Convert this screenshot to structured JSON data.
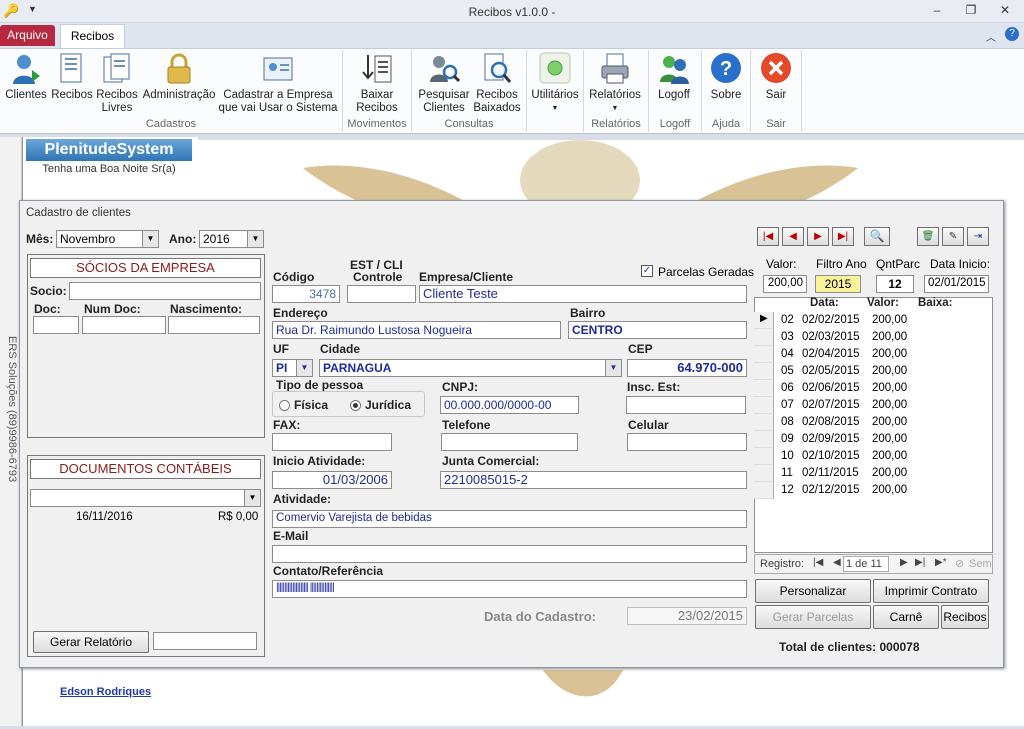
{
  "window": {
    "title": "Recibos v1.0.0 -"
  },
  "tabs": {
    "arquivo": "Arquivo",
    "recibos": "Recibos"
  },
  "ribbon": {
    "clientes": "Clientes",
    "recibos": "Recibos",
    "recibos_livres": "Recibos\nLivres",
    "administracao": "Administração",
    "cadastrar": "Cadastrar a Empresa\nque vai Usar o Sistema",
    "baixar": "Baixar\nRecibos",
    "pesquisar": "Pesquisar\nClientes",
    "recibos_baixados": "Recibos\nBaixados",
    "utilitarios": "Utilitários",
    "relatorios": "Relatórios",
    "logoff": "Logoff",
    "sobre": "Sobre",
    "sair": "Sair",
    "groups": {
      "cadastros": "Cadastros",
      "movimentos": "Movimentos",
      "consultas": "Consultas",
      "relatorios": "Relatórios",
      "logoff": "Logoff",
      "ajuda": "Ajuda",
      "sair": "Sair"
    }
  },
  "sidebar": {
    "brand": "PlenitudeSystem",
    "greeting": "Tenha uma Boa Noite Sr(a)",
    "vertical": "ERS Soluções (89)9986-6793",
    "link": "Edson Rodriques"
  },
  "dialog": {
    "title": "Cadastro de clientes",
    "mes_label": "Mês:",
    "mes_value": "Novembro",
    "ano_label": "Ano:",
    "ano_value": "2016",
    "socios_header": "SÓCIOS DA EMPRESA",
    "socio_label": "Socio:",
    "doc_label": "Doc:",
    "numdoc_label": "Num Doc:",
    "nasc_label": "Nascimento:",
    "docs_header": "DOCUMENTOS CONTÁBEIS",
    "doc_date": "16/11/2016",
    "doc_value": "R$ 0,00",
    "gerar_relatorio": "Gerar Relatório",
    "codigo_label": "Código",
    "codigo": "3478",
    "est_label": "EST / CLI",
    "controle_label": "Controle",
    "controle": "",
    "empresa_label": "Empresa/Cliente",
    "empresa": "Cliente Teste",
    "parcelas_geradas": "Parcelas Geradas",
    "endereco_label": "Endereço",
    "endereco": "Rua Dr. Raimundo Lustosa Nogueira",
    "bairro_label": "Bairro",
    "bairro": "CENTRO",
    "uf_label": "UF",
    "uf": "PI",
    "cidade_label": "Cidade",
    "cidade": "PARNAGUA",
    "cep_label": "CEP",
    "cep": "64.970-000",
    "tipo_label": "Tipo de pessoa",
    "fisica": "Física",
    "juridica": "Jurídica",
    "cnpj_label": "CNPJ:",
    "cnpj": "00.000.000/0000-00",
    "insc_label": "Insc. Est:",
    "fax_label": "FAX:",
    "telefone_label": "Telefone",
    "celular_label": "Celular",
    "inicio_label": "Inicio Atividade:",
    "inicio": "01/03/2006",
    "junta_label": "Junta Comercial:",
    "junta": "2210085015-2",
    "atividade_label": "Atividade:",
    "atividade": "Comervio Varejista de bebidas",
    "email_label": "E-Mail",
    "contato_label": "Contato/Referência",
    "contato": "|||||||||||||||||||| |||||||||||||||",
    "data_cad_label": "Data do Cadastro:",
    "data_cad": "23/02/2015",
    "valor_label": "Valor:",
    "valor": "200,00",
    "filtro_label": "Filtro Ano",
    "filtro": "2015",
    "qnt_label": "QntParc",
    "qnt": "12",
    "datainicio_label": "Data Inicio:",
    "datainicio": "02/01/2015",
    "grid_head": {
      "data": "Data:",
      "valor": "Valor:",
      "baixa": "Baixa:"
    },
    "rows": [
      {
        "n": "02",
        "d": "02/02/2015",
        "v": "200,00"
      },
      {
        "n": "03",
        "d": "02/03/2015",
        "v": "200,00"
      },
      {
        "n": "04",
        "d": "02/04/2015",
        "v": "200,00"
      },
      {
        "n": "05",
        "d": "02/05/2015",
        "v": "200,00"
      },
      {
        "n": "06",
        "d": "02/06/2015",
        "v": "200,00"
      },
      {
        "n": "07",
        "d": "02/07/2015",
        "v": "200,00"
      },
      {
        "n": "08",
        "d": "02/08/2015",
        "v": "200,00"
      },
      {
        "n": "09",
        "d": "02/09/2015",
        "v": "200,00"
      },
      {
        "n": "10",
        "d": "02/10/2015",
        "v": "200,00"
      },
      {
        "n": "11",
        "d": "02/11/2015",
        "v": "200,00"
      },
      {
        "n": "12",
        "d": "02/12/2015",
        "v": "200,00"
      }
    ],
    "registro": "Registro:",
    "pager": "1 de 11",
    "sem": "Sem",
    "personalizar": "Personalizar Contrato",
    "imprimir": "Imprimir Contrato",
    "gerar_parcelas": "Gerar Parcelas",
    "carne": "Carnê",
    "recibos_btn": "Recibos",
    "total": "Total de clientes: 000078"
  }
}
